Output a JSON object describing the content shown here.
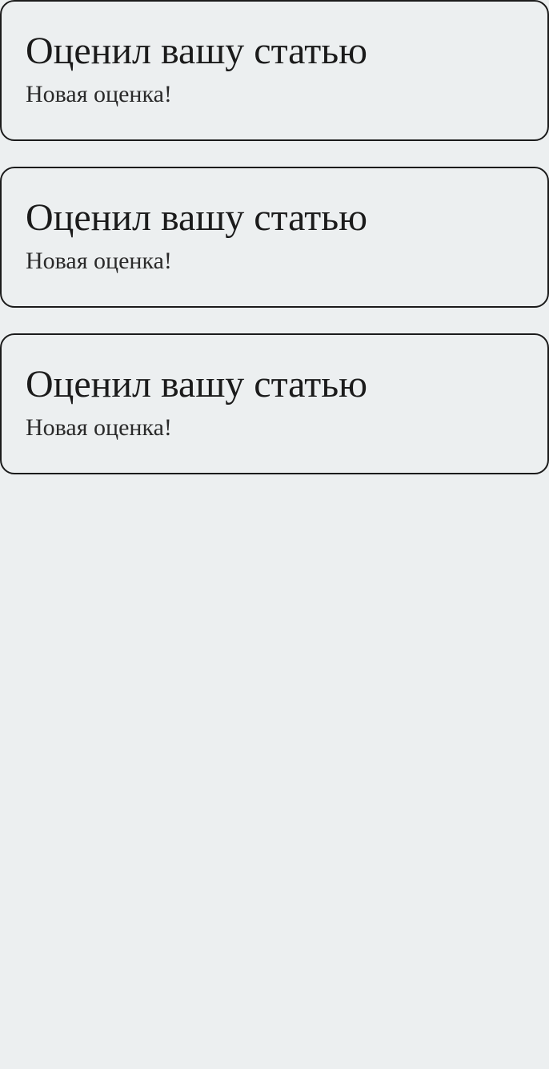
{
  "notifications": [
    {
      "title": "Оценил вашу статью",
      "subtitle": "Новая оценка!"
    },
    {
      "title": "Оценил вашу статью",
      "subtitle": "Новая оценка!"
    },
    {
      "title": "Оценил вашу статью",
      "subtitle": "Новая оценка!"
    }
  ]
}
